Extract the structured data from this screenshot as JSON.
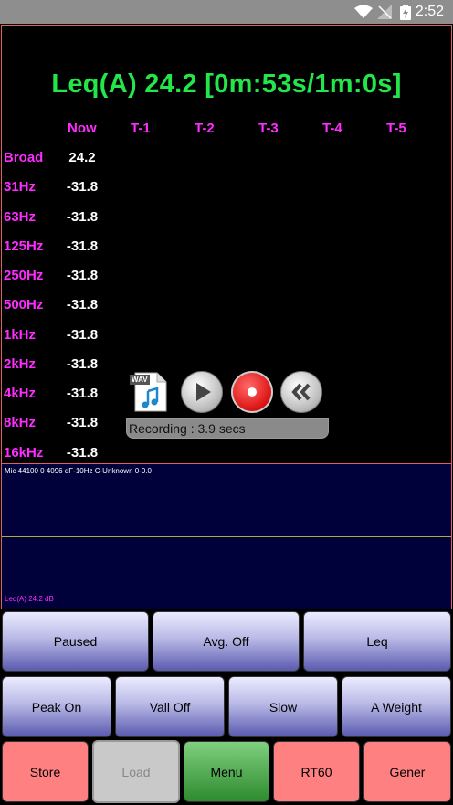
{
  "status_bar": {
    "time": "2:52"
  },
  "leq_title": "Leq(A)  24.2 [0m:53s/1m:0s]",
  "table": {
    "columns": [
      "Now",
      "T-1",
      "T-2",
      "T-3",
      "T-4",
      "T-5"
    ],
    "rows": [
      {
        "label": "Broad",
        "now": "24.2"
      },
      {
        "label": "31Hz",
        "now": "-31.8"
      },
      {
        "label": "63Hz",
        "now": "-31.8"
      },
      {
        "label": "125Hz",
        "now": "-31.8"
      },
      {
        "label": "250Hz",
        "now": "-31.8"
      },
      {
        "label": "500Hz",
        "now": "-31.8"
      },
      {
        "label": "1kHz",
        "now": "-31.8"
      },
      {
        "label": "2kHz",
        "now": "-31.8"
      },
      {
        "label": "4kHz",
        "now": "-31.8"
      },
      {
        "label": "8kHz",
        "now": "-31.8"
      },
      {
        "label": "16kHz",
        "now": "-31.8"
      }
    ]
  },
  "recorder": {
    "status": "Recording :  3.9 secs",
    "wav_label": "WAV"
  },
  "plot": {
    "info": "Mic 44100 0 4096 dF-10Hz C-Unknown 0-0.0",
    "leq": "Leq(A)  24.2 dB"
  },
  "buttons": {
    "row1": [
      "Paused",
      "Avg. Off",
      "Leq"
    ],
    "row2": [
      "Peak On",
      "Vall Off",
      "Slow",
      "A Weight"
    ],
    "row3": [
      "Store",
      "Load",
      "Menu",
      "RT60",
      "Gener"
    ]
  }
}
